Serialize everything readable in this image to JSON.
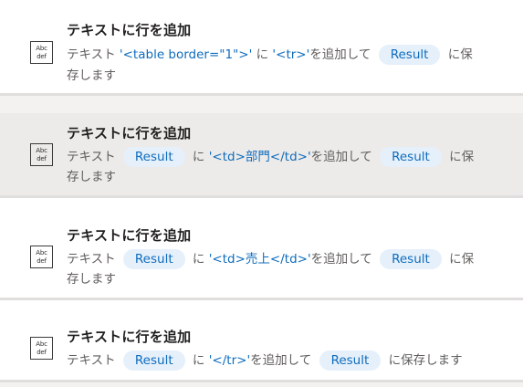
{
  "steps": [
    {
      "title": "テキストに行を追加",
      "icon": "abc-def-text-icon",
      "icon_line1": "Abc",
      "icon_line2": "def",
      "prefix": "テキスト",
      "text_literal": "'<table border=\"1\">'",
      "to": "に",
      "line_literal": "'<tr>'",
      "add": "を追加して",
      "result_var": "Result",
      "save_tail": "に保",
      "save_rest": "存します"
    },
    {
      "title": "テキストに行を追加",
      "icon": "abc-def-text-icon",
      "icon_line1": "Abc",
      "icon_line2": "def",
      "prefix": "テキスト",
      "text_var": "Result",
      "to": "に",
      "line_literal": "'<td>部門</td>'",
      "add": "を追加して",
      "result_var": "Result",
      "save_tail": "に保",
      "save_rest": "存します"
    },
    {
      "title": "テキストに行を追加",
      "icon": "abc-def-text-icon",
      "icon_line1": "Abc",
      "icon_line2": "def",
      "prefix": "テキスト",
      "text_var": "Result",
      "to": "に",
      "line_literal": "'<td>売上</td>'",
      "add": "を追加して",
      "result_var": "Result",
      "save_tail": "に保",
      "save_rest": "存します"
    },
    {
      "title": "テキストに行を追加",
      "icon": "abc-def-text-icon",
      "icon_line1": "Abc",
      "icon_line2": "def",
      "prefix": "テキスト",
      "text_var": "Result",
      "to": "に",
      "line_literal": "'</tr>'",
      "add": "を追加して",
      "result_var": "Result",
      "save_full": "に保存します"
    }
  ]
}
